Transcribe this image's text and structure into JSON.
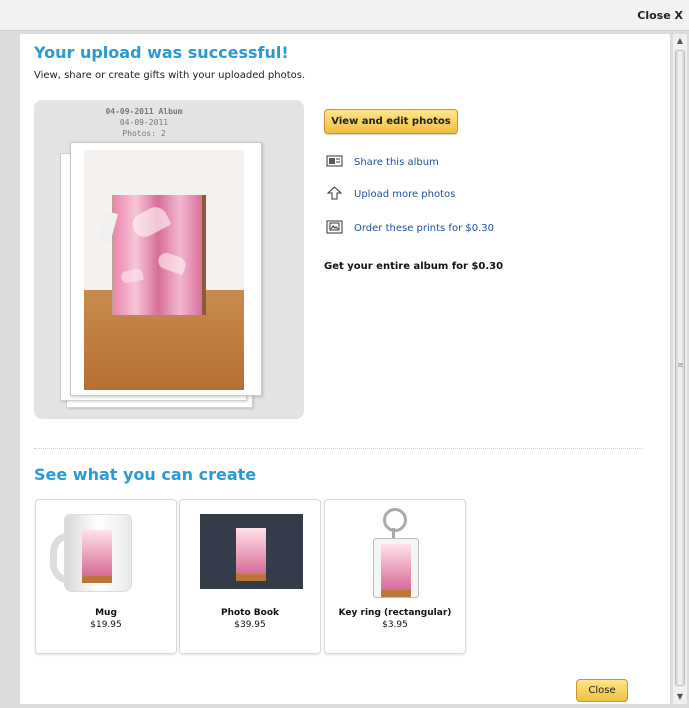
{
  "window": {
    "close_label": "Close X"
  },
  "header": {
    "title": "Your upload was successful!",
    "subtitle": "View, share or create gifts with your uploaded photos."
  },
  "album": {
    "title": "04-09-2011 Album",
    "date": "04-09-2011",
    "photo_count": "Photos: 2"
  },
  "actions": {
    "view_edit_label": "View and edit photos",
    "share_label": "Share this album",
    "upload_label": "Upload more photos",
    "order_label": "Order these prints for $0.30",
    "entire_album_label": "Get your entire album for $0.30"
  },
  "create_section": {
    "title": "See what you can create"
  },
  "products": [
    {
      "name": "Mug",
      "price": "$19.95"
    },
    {
      "name": "Photo Book",
      "price": "$39.95"
    },
    {
      "name": "Key ring (rectangular)",
      "price": "$3.95"
    }
  ],
  "footer": {
    "close_label": "Close"
  },
  "icons": {
    "share": "share-icon",
    "upload": "upload-icon",
    "order": "print-icon"
  },
  "colors": {
    "heading": "#2a9ad3",
    "button": "#f1bf41",
    "link": "#1f4fa0"
  }
}
